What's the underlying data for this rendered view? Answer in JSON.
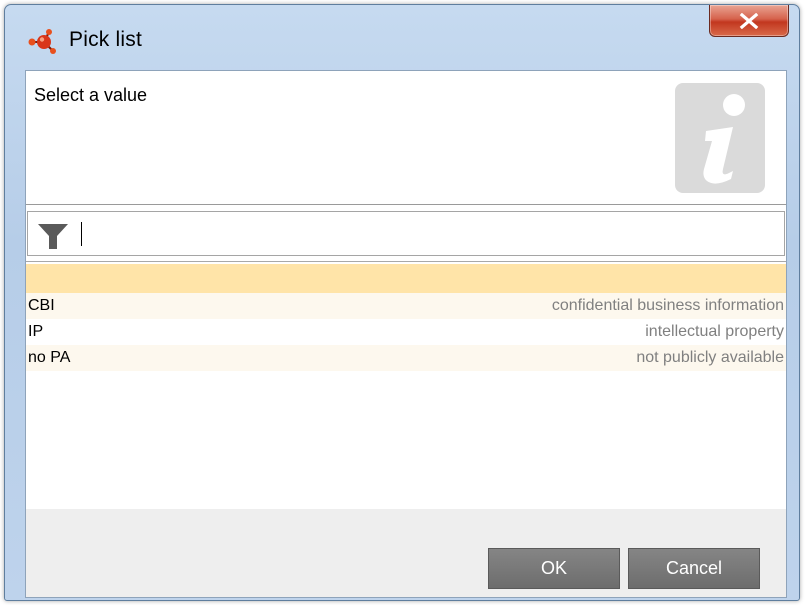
{
  "window": {
    "title": "Pick list",
    "app_icon": "molecule-icon",
    "close_icon": "close-x-icon"
  },
  "message": {
    "text": "Select a value",
    "icon": "info-icon"
  },
  "filter": {
    "icon": "funnel-icon",
    "value": ""
  },
  "list": {
    "items": [
      {
        "code": "",
        "description": ""
      },
      {
        "code": "CBI",
        "description": "confidential business information"
      },
      {
        "code": "IP",
        "description": "intellectual property"
      },
      {
        "code": "no PA",
        "description": "not publicly available"
      }
    ]
  },
  "buttons": {
    "ok": "OK",
    "cancel": "Cancel"
  },
  "colors": {
    "selected_row": "#ffe4a8",
    "close_button": "#c2371f",
    "button_gray": "#6d6d6d"
  }
}
